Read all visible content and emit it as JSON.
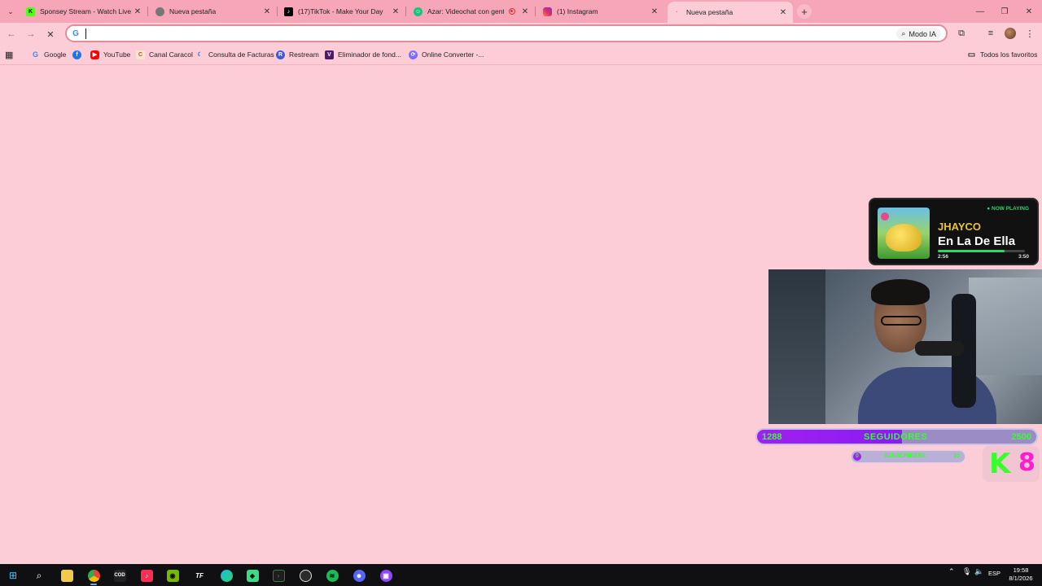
{
  "tabs": [
    {
      "title": "Sponsey Stream - Watch Live o",
      "favicon": "kick-icon",
      "color": "#53fc18"
    },
    {
      "title": "Nueva pestaña",
      "favicon": "chrome-icon",
      "color": "#555555"
    },
    {
      "title": "(17)TikTok - Make Your Day",
      "favicon": "tiktok-icon",
      "color": "#000000"
    },
    {
      "title": "Azar: Videochat con gente",
      "favicon": "azar-icon",
      "color": "#18c47a"
    },
    {
      "title": "(1) Instagram",
      "favicon": "instagram-icon",
      "color": "#dd2a7b"
    },
    {
      "title": "Nueva pestaña",
      "favicon": "loading-icon",
      "color": "#888888"
    }
  ],
  "omnibox": {
    "value": "",
    "ai_mode_label": "Modo IA"
  },
  "bookmarks": [
    {
      "label": "Google",
      "icon": "google-icon"
    },
    {
      "label": "",
      "icon": "facebook-icon"
    },
    {
      "label": "YouTube",
      "icon": "youtube-icon"
    },
    {
      "label": "Canal Caracol",
      "icon": "caracol-icon"
    },
    {
      "label": "Consulta de Facturas",
      "icon": "facturas-icon"
    },
    {
      "label": "Restream",
      "icon": "restream-icon"
    },
    {
      "label": "Eliminador de fond...",
      "icon": "eliminador-icon"
    },
    {
      "label": "Online Converter -...",
      "icon": "converter-icon"
    }
  ],
  "all_bookmarks_label": "Todos los favoritos",
  "now_playing": {
    "badge": "● NOW PLAYING",
    "artist": "JHAYCO",
    "song": "En La De Ella",
    "elapsed": "2:56",
    "duration": "3:50",
    "progress": 0.77
  },
  "followers": {
    "current": "1288",
    "label": "SEGUIDORES",
    "goal": "2500",
    "progress": 0.52
  },
  "subscribers": {
    "current": "0",
    "label": "SUBSCRIBERS",
    "goal": "10",
    "progress": 0.0
  },
  "kick_badge": {
    "letter": "K",
    "number": "8"
  },
  "taskbar": {
    "apps": [
      "windows-icon",
      "search-icon",
      "file-explorer-icon",
      "chrome-icon",
      "call-of-duty-icon",
      "tiktok-icon",
      "nvidia-icon",
      "tf-icon",
      "edge-icon",
      "android-studio-icon",
      "terminal-icon",
      "obs-icon",
      "spotify-icon",
      "discord-icon",
      "twitch-icon"
    ],
    "lang": "ESP",
    "time": "19:58",
    "date": "8/1/2026"
  },
  "colors": {
    "accent": "#f6a6b6",
    "page_bg": "#fccdd7",
    "kick_green": "#36ff2b",
    "follow_purple": "#a020f0"
  }
}
